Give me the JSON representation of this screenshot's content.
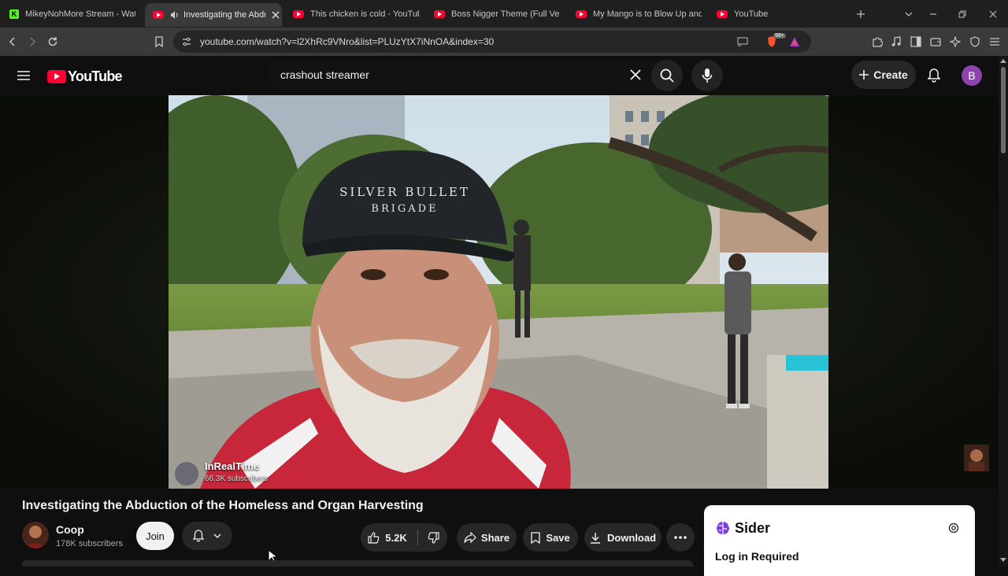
{
  "browser": {
    "tabs": [
      {
        "title": "MikeyNohMore Stream - Watch",
        "favicon": "kick-icon",
        "active": false
      },
      {
        "title": "Investigating the Abduc",
        "favicon": "youtube-icon",
        "active": true,
        "audio": true
      },
      {
        "title": "This chicken is cold - YouTube",
        "favicon": "youtube-icon",
        "active": false
      },
      {
        "title": "Boss Nigger Theme (Full Versio",
        "favicon": "youtube-icon",
        "active": false
      },
      {
        "title": "My Mango is to Blow Up and T",
        "favicon": "youtube-icon",
        "active": false
      },
      {
        "title": "YouTube",
        "favicon": "youtube-icon",
        "active": false
      }
    ],
    "url": "youtube.com/watch?v=l2XhRc9VNro&list=PLUzYtX7iNnOA&index=30",
    "brave_badge": "99+"
  },
  "youtube": {
    "logo_text": "YouTube",
    "search": {
      "value": "crashout streamer"
    },
    "create_label": "Create",
    "account_initial": "B"
  },
  "video": {
    "watermark": {
      "name": "InRealTime",
      "subscribers": "66.3K subscribers"
    },
    "cap_text": "SILVER BULLET BRIGADE",
    "title": "Investigating the Abduction of the Homeless and Organ Harvesting"
  },
  "channel": {
    "name": "Coop",
    "subscribers": "178K subscribers",
    "join_label": "Join"
  },
  "actions": {
    "likes": "5.2K",
    "share": "Share",
    "save": "Save",
    "download": "Download"
  },
  "sider": {
    "title": "Sider",
    "message": "Log in Required"
  },
  "colors": {
    "youtube_red": "#ff0033",
    "kick_green": "#53fc18",
    "sider_purple": "#7b3fe4"
  }
}
